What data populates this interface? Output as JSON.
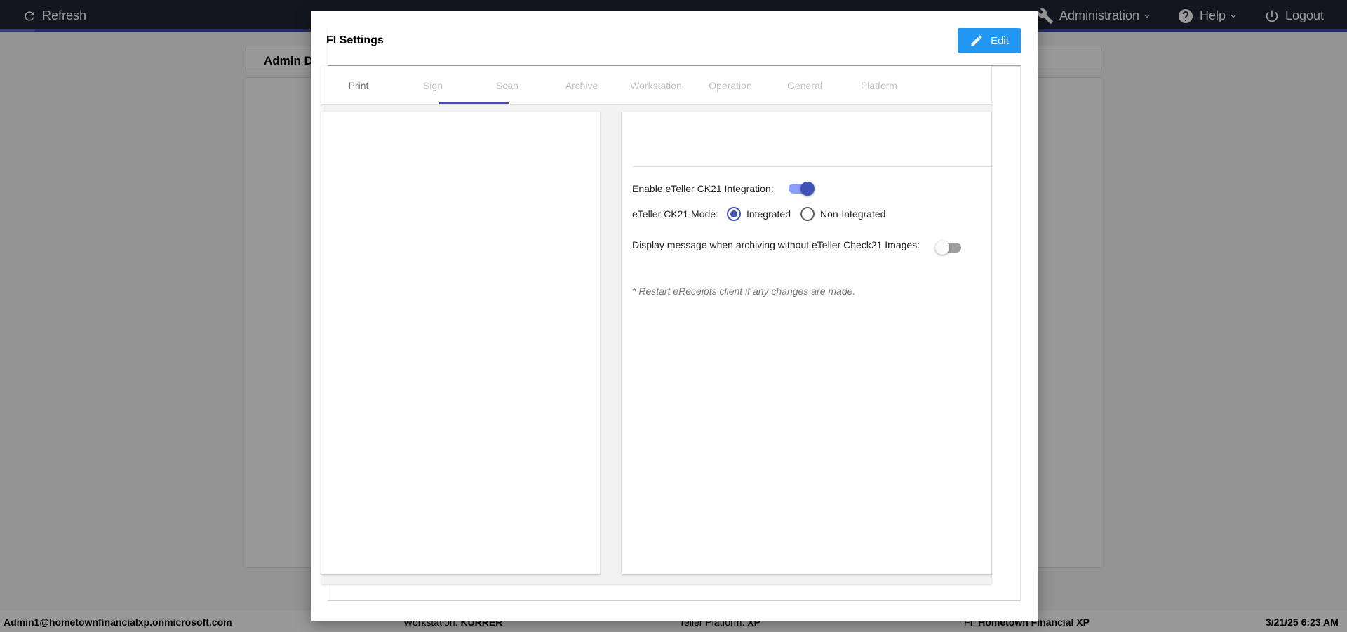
{
  "topbar": {
    "refresh_label": "Refresh",
    "administration_label": "Administration",
    "help_label": "Help",
    "logout_label": "Logout"
  },
  "background": {
    "admin_title": "Admin D"
  },
  "modal": {
    "title": "FI Settings",
    "edit_label": "Edit",
    "tabs": [
      {
        "label": "Print"
      },
      {
        "label": "Sign"
      },
      {
        "label": "Scan"
      },
      {
        "label": "Archive"
      },
      {
        "label": "Workstation"
      },
      {
        "label": "Operation"
      },
      {
        "label": "General"
      },
      {
        "label": "Platform"
      }
    ],
    "active_tab": "Scan",
    "settings": {
      "enable_ck21_label": "Enable eTeller CK21 Integration:",
      "enable_ck21_value": true,
      "mode_label": "eTeller CK21 Mode:",
      "mode_options": [
        "Integrated",
        "Non-Integrated"
      ],
      "mode_selected": "Integrated",
      "display_msg_label": "Display message when archiving without eTeller Check21 Images:",
      "display_msg_value": false,
      "note": "* Restart eReceipts client if any changes are made."
    }
  },
  "statusbar": {
    "user": "Admin1@hometownfinancialxp.onmicrosoft.com",
    "workstation_label": "Workstation:",
    "workstation_value": "KURRER",
    "platform_label": "Teller Platform:",
    "platform_value": "XP",
    "fi_label": "FI:",
    "fi_value": "Hometown Financial XP",
    "datetime": "3/21/25 6:23 AM"
  },
  "colors": {
    "topbar_bg": "#1f2533",
    "accent": "#3f51b5",
    "edit_button": "#2196f3"
  }
}
